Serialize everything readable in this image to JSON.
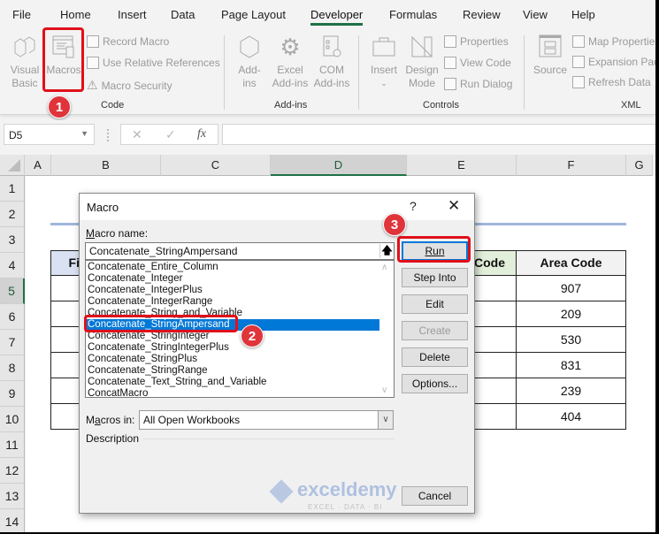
{
  "menu": {
    "tabs": [
      {
        "label": "File",
        "active": false
      },
      {
        "label": "Home",
        "active": false
      },
      {
        "label": "Insert",
        "active": false
      },
      {
        "label": "Data",
        "active": false
      },
      {
        "label": "Page Layout",
        "active": false
      },
      {
        "label": "Developer",
        "active": true
      },
      {
        "label": "Formulas",
        "active": false
      },
      {
        "label": "Review",
        "active": false
      },
      {
        "label": "View",
        "active": false
      },
      {
        "label": "Help",
        "active": false
      }
    ]
  },
  "ribbon": {
    "code": {
      "label": "Code",
      "visual_basic": [
        "Visual",
        "Basic"
      ],
      "macros": "Macros",
      "record_macro": "Record Macro",
      "relative_refs": "Use Relative References",
      "macro_security": "Macro Security"
    },
    "addins": {
      "label": "Add-ins",
      "addins": [
        "Add-",
        "ins"
      ],
      "excel_addins": [
        "Excel",
        "Add-ins"
      ],
      "com_addins": [
        "COM",
        "Add-ins"
      ]
    },
    "controls": {
      "label": "Controls",
      "insert": "Insert",
      "design_mode": [
        "Design",
        "Mode"
      ],
      "properties": "Properties",
      "view_code": "View Code",
      "run_dialog": "Run Dialog"
    },
    "xml": {
      "label": "XML",
      "source": "Source",
      "map_properties": "Map Properties",
      "expansion_packs": "Expansion Packs",
      "refresh_data": "Refresh Data"
    }
  },
  "formula_bar": {
    "name_box": "D5",
    "cancel_icon": "✕",
    "enter_icon": "✓",
    "fx_label": "fx",
    "formula": ""
  },
  "sheet": {
    "columns": [
      "A",
      "B",
      "C",
      "D",
      "E",
      "F",
      "G"
    ],
    "selected_column": "D",
    "rows": [
      "1",
      "2",
      "3",
      "4",
      "5",
      "6",
      "7",
      "8",
      "9",
      "10",
      "11",
      "12",
      "13",
      "14"
    ],
    "selected_row": "5",
    "table": {
      "headers": {
        "first_partial": "Fi",
        "e_partial": "Code",
        "area_code": "Area Code"
      },
      "area_codes": [
        "907",
        "209",
        "530",
        "831",
        "239",
        "404"
      ]
    }
  },
  "dialog": {
    "title": "Macro",
    "help": "?",
    "close": "✕",
    "macro_name_label": "acro name:",
    "macro_name_label_accel": "M",
    "macro_name_value": "Concatenate_StringAmpersand",
    "macros": [
      "Concatenate_Entire_Column",
      "Concatenate_Integer",
      "Concatenate_IntegerPlus",
      "Concatenate_IntegerRange",
      "Concatenate_String_and_Variable",
      "Concatenate_StringAmpersand",
      "Concatenate_StringInteger",
      "Concatenate_StringIntegerPlus",
      "Concatenate_StringPlus",
      "Concatenate_StringRange",
      "Concatenate_Text_String_and_Variable",
      "ConcatMacro"
    ],
    "selected_index": 5,
    "buttons": {
      "run": "Run",
      "step_into": "Step Into",
      "edit": "Edit",
      "create": "Create",
      "delete": "Delete",
      "options": "Options...",
      "cancel": "Cancel"
    },
    "macros_in_label_pre": "M",
    "macros_in_label_accel": "a",
    "macros_in_label_post": "cros in:",
    "macros_in_value": "All Open Workbooks",
    "description_label": "Description"
  },
  "annotations": {
    "step1": "1",
    "step2": "2",
    "step3": "3",
    "highlight_color": "#e0101a"
  },
  "watermark": {
    "brand": "exceldemy",
    "tagline": "EXCEL · DATA · BI"
  }
}
